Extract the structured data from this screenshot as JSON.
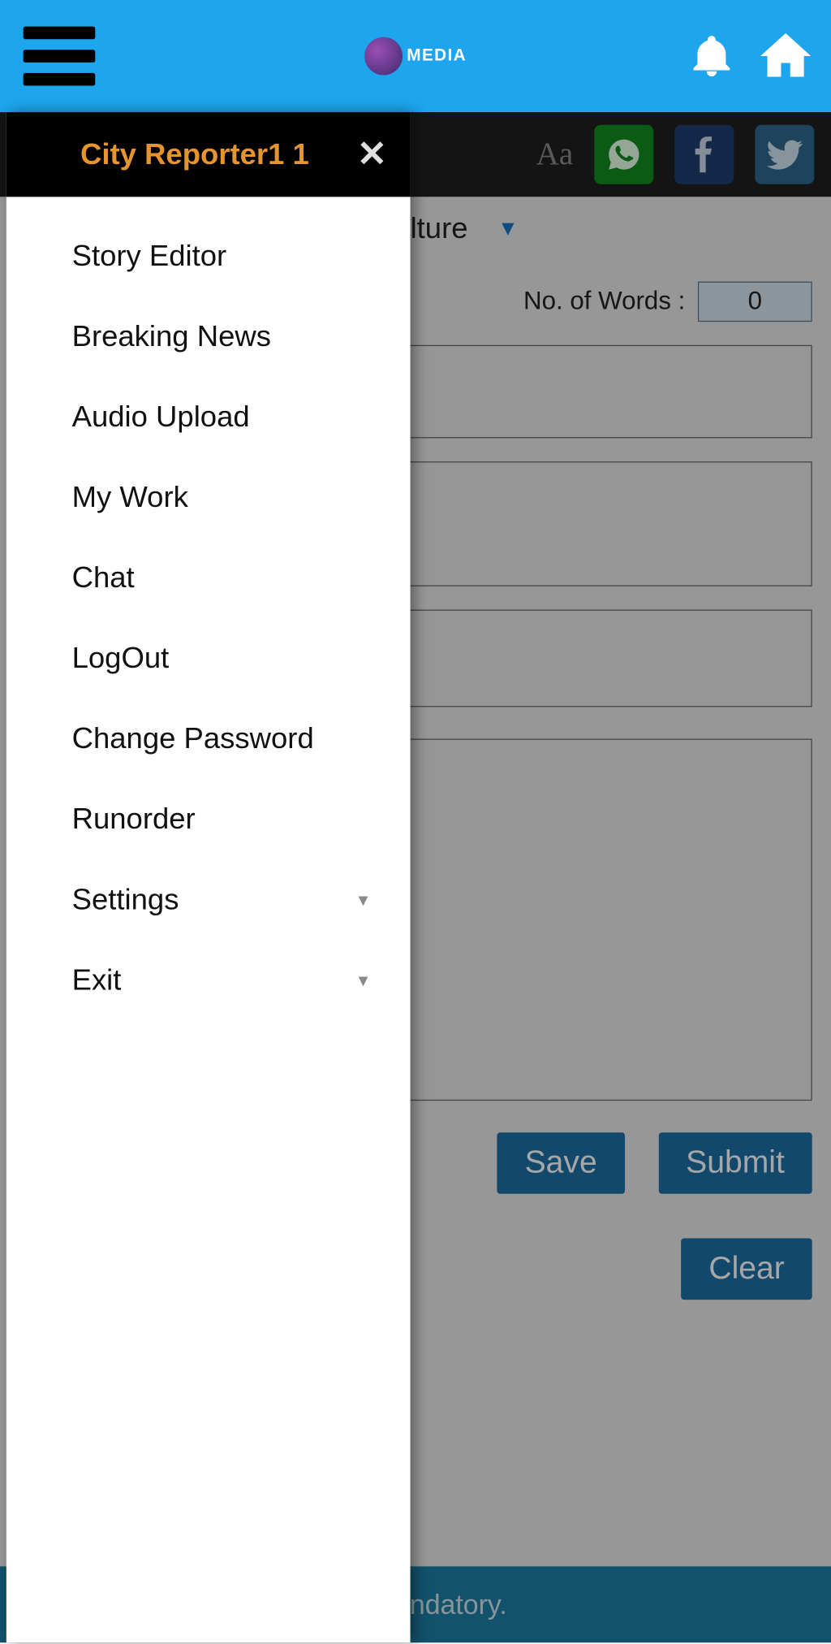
{
  "header": {
    "logo_text": "MEDIA"
  },
  "subbar": {
    "aa_label": "Aa"
  },
  "content": {
    "dropdown_visible": "lture",
    "words_label": "No. of Words :",
    "words_value": "0",
    "buttons": {
      "save": "Save",
      "submit": "Submit",
      "clear": "Clear"
    }
  },
  "footer_text": "are mandatory.",
  "drawer": {
    "title": "City Reporter1 1",
    "items": [
      {
        "label": "Story Editor",
        "expandable": false
      },
      {
        "label": "Breaking News",
        "expandable": false
      },
      {
        "label": "Audio Upload",
        "expandable": false
      },
      {
        "label": "My Work",
        "expandable": false
      },
      {
        "label": "Chat",
        "expandable": false
      },
      {
        "label": "LogOut",
        "expandable": false
      },
      {
        "label": "Change Password",
        "expandable": false
      },
      {
        "label": "Runorder",
        "expandable": false
      },
      {
        "label": "Settings",
        "expandable": true
      },
      {
        "label": "Exit",
        "expandable": true
      }
    ]
  }
}
